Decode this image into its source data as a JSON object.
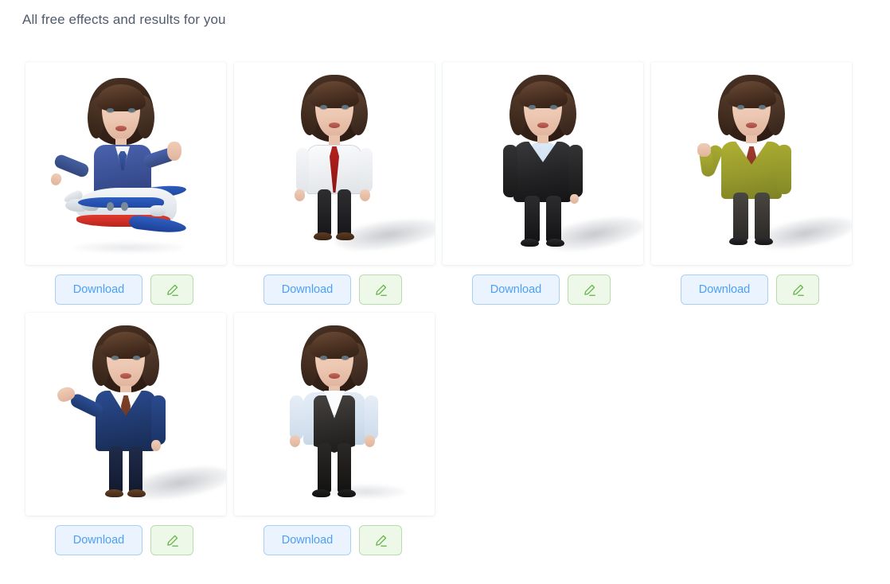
{
  "page": {
    "title": "All free effects and results for you",
    "background_color": "#ffffff",
    "title_color": "#515a6e"
  },
  "theme": {
    "download_bg": "#eaf3fe",
    "download_border": "#a8d0f7",
    "download_text": "#4ea0f5",
    "edit_bg": "#eef8e9",
    "edit_border": "#b6ddab",
    "edit_icon": "#5cb33f",
    "card_bg": "#ffffff"
  },
  "actions": {
    "download_label": "Download",
    "edit_icon_name": "pencil-edit-icon"
  },
  "results": [
    {
      "id": 1,
      "alt": "Cartoon avatar of woman in blue pilot uniform sitting on a toy airplane",
      "variant": "pilot-plane",
      "download_label": "Download",
      "edit_label": ""
    },
    {
      "id": 2,
      "alt": "Cartoon avatar in white shirt with red tie and black trousers",
      "variant": "white-shirt-red-tie",
      "download_label": "Download",
      "edit_label": ""
    },
    {
      "id": 3,
      "alt": "Cartoon avatar in black suit with light blue shirt",
      "variant": "black-suit",
      "download_label": "Download",
      "edit_label": ""
    },
    {
      "id": 4,
      "alt": "Cartoon avatar in olive blazer with red tie raising a fist",
      "variant": "olive-blazer",
      "download_label": "Download",
      "edit_label": ""
    },
    {
      "id": 5,
      "alt": "Cartoon avatar in navy blue suit with brown tie gesturing with open palm",
      "variant": "navy-suit",
      "download_label": "Download",
      "edit_label": ""
    },
    {
      "id": 6,
      "alt": "Cartoon avatar in dark waistcoat over light blue rolled-up shirt, hands in pockets",
      "variant": "vest-shirt",
      "download_label": "Download",
      "edit_label": ""
    }
  ]
}
